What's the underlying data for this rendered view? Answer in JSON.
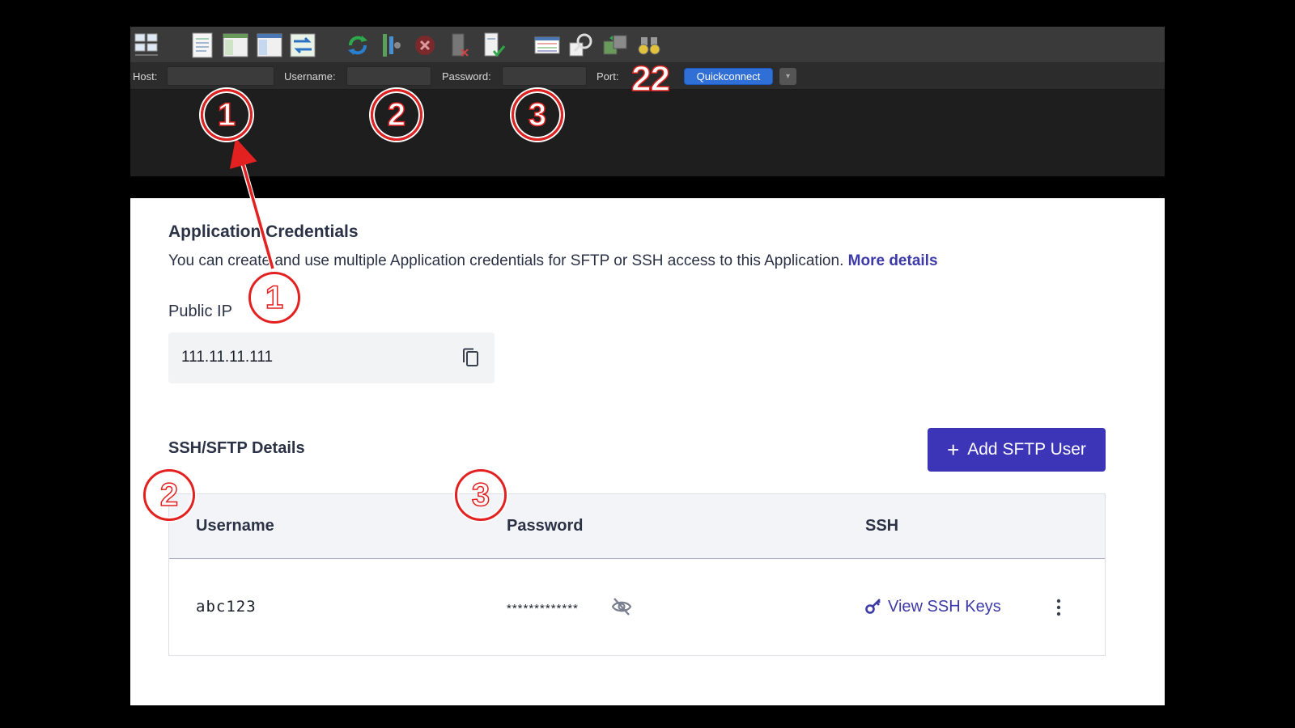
{
  "toolbar": {
    "icons": [
      "site-manager-icon",
      "toggle-message-log-icon",
      "toggle-local-tree-icon",
      "toggle-remote-tree-icon",
      "toggle-transfer-queue-icon",
      "refresh-icon",
      "process-queue-icon",
      "cancel-icon",
      "disconnect-icon",
      "reconnect-icon",
      "directory-listing-filters-icon",
      "synchronized-browsing-icon",
      "directory-comparison-icon",
      "search-remote-files-icon"
    ]
  },
  "quickconnect": {
    "host_label": "Host:",
    "host_value": "",
    "username_label": "Username:",
    "username_value": "",
    "password_label": "Password:",
    "password_value": "",
    "port_label": "Port:",
    "port_value": "22",
    "button_label": "Quickconnect",
    "dropdown_glyph": "▾"
  },
  "credentials": {
    "title": "Application Credentials",
    "description": "You can create and use multiple Application credentials for SFTP or SSH access to this Application.",
    "more_details_link": "More details",
    "public_ip_label": "Public IP",
    "public_ip_value": "111.11.11.111"
  },
  "ssh_sftp": {
    "title": "SSH/SFTP Details",
    "add_button_icon": "+",
    "add_button_label": "Add SFTP User",
    "columns": [
      "Username",
      "Password",
      "SSH"
    ],
    "rows": [
      {
        "username": "abc123",
        "password_masked": "*************",
        "ssh_link": "View SSH Keys"
      }
    ]
  },
  "annotations": {
    "markers": [
      "1",
      "2",
      "3",
      "1",
      "2",
      "3"
    ]
  },
  "colors": {
    "annotation_red": "#e32121",
    "brand_purple": "#3d35b8",
    "link_purple": "#3d3aa8",
    "quickconnect_blue": "#2f6fd6"
  }
}
